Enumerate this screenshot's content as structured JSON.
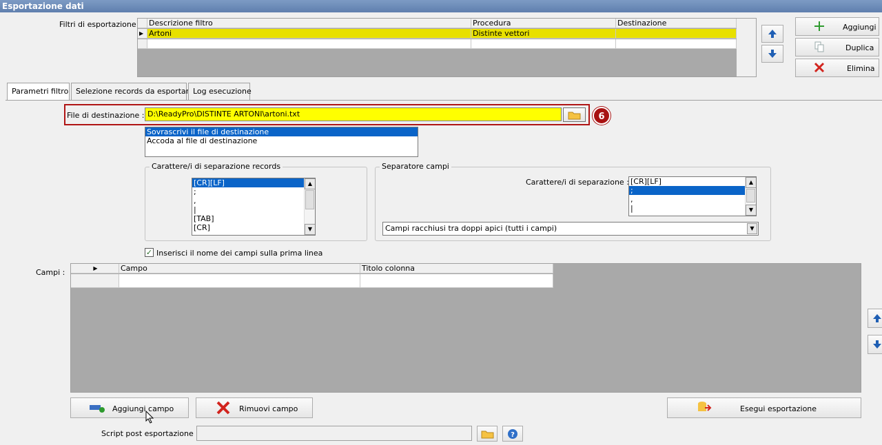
{
  "window": {
    "title": "Esportazione dati"
  },
  "filters": {
    "label": "Filtri di esportazione :",
    "columns": [
      "Descrizione filtro",
      "Procedura",
      "Destinazione"
    ],
    "rows": [
      {
        "descrizione": "Artoni",
        "procedura": "Distinte vettori",
        "destinazione": ""
      },
      {
        "descrizione": "",
        "procedura": "",
        "destinazione": ""
      }
    ]
  },
  "side_buttons": {
    "add": "Aggiungi",
    "duplicate": "Duplica",
    "delete": "Elimina"
  },
  "tabs": [
    "Parametri filtro",
    "Selezione records da esportare",
    "Log esecuzione"
  ],
  "dest_file": {
    "label": "File di destinazione :",
    "value": "D:\\ReadyPro\\DISTINTE ARTONI\\artoni.txt",
    "annotation": "6"
  },
  "write_mode": {
    "options": [
      "Sovrascrivi il file di destinazione",
      "Accoda al file di destinazione"
    ],
    "selected": 0
  },
  "record_sep": {
    "title": "Carattere/i di separazione records",
    "options": [
      "[CR][LF]",
      ";",
      ",",
      "|",
      "[TAB]",
      "[CR]"
    ],
    "selected": 0
  },
  "field_sep": {
    "title": "Separatore campi",
    "label": "Carattere/i di separazione :",
    "options": [
      "[CR][LF]",
      ";",
      ",",
      "|"
    ],
    "selected": 1,
    "quote_mode": "Campi racchiusi tra doppi apici (tutti i campi)"
  },
  "header_checkbox": {
    "label": "Inserisci il nome dei campi sulla prima linea",
    "checked": true
  },
  "fields": {
    "label": "Campi :",
    "columns": [
      "Campo",
      "Titolo colonna"
    ]
  },
  "actions": {
    "add_field": "Aggiungi campo",
    "remove_field": "Rimuovi campo",
    "run_export": "Esegui esportazione"
  },
  "script": {
    "label": "Script post esportazione :",
    "value": ""
  },
  "colors": {
    "titlebar": "#6b8ab8",
    "highlight_yellow": "#e8e000",
    "selection_blue": "#0a64c8",
    "annotation_red": "#b01414"
  }
}
